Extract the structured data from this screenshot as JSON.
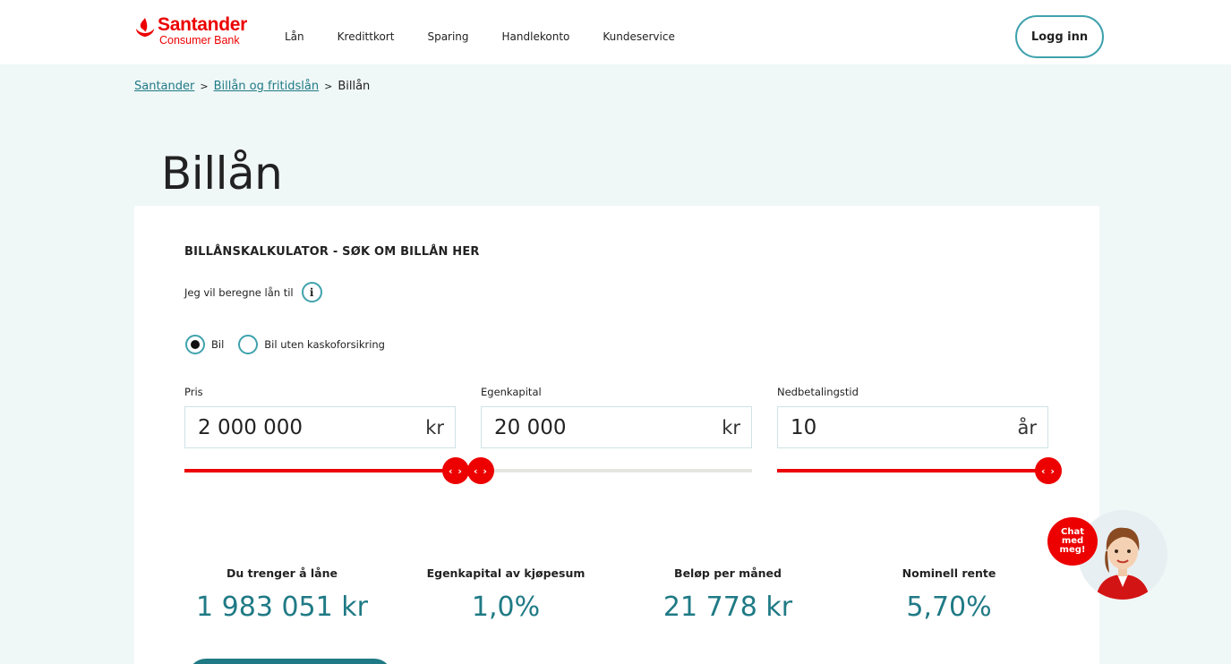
{
  "brand": {
    "name": "Santander",
    "sub": "Consumer Bank",
    "color": "#ec0000",
    "accent": "#3fa2ad"
  },
  "nav": {
    "items": [
      "Lån",
      "Kredittkort",
      "Sparing",
      "Handlekonto",
      "Kundeservice"
    ],
    "login_label": "Logg inn"
  },
  "breadcrumb": {
    "items": [
      "Santander",
      "Billån og fritidslån",
      "Billån"
    ],
    "separator": ">"
  },
  "page": {
    "title": "Billån"
  },
  "calculator": {
    "heading": "BILLÅNSKALKULATOR - SØK OM BILLÅN HER",
    "subheading": "Jeg vil beregne lån til",
    "info_icon": "info-icon",
    "options": [
      {
        "label": "Bil",
        "selected": true
      },
      {
        "label": "Bil uten kaskoforsikring",
        "selected": false
      }
    ],
    "fields": [
      {
        "label": "Pris",
        "value": "2 000 000",
        "unit": "kr",
        "slider_fraction": 1.0
      },
      {
        "label": "Egenkapital",
        "value": "20 000",
        "unit": "kr",
        "slider_fraction": 0.0
      },
      {
        "label": "Nedbetalingstid",
        "value": "10",
        "unit": "år",
        "slider_fraction": 1.0
      }
    ],
    "handle_glyph": "‹ ›",
    "results": [
      {
        "label": "Du trenger å låne",
        "value": "1 983 051 kr"
      },
      {
        "label": "Egenkapital av kjøpesum",
        "value": "1,0%"
      },
      {
        "label": "Beløp per måned",
        "value": "21 778 kr"
      },
      {
        "label": "Nominell rente",
        "value": "5,70%"
      }
    ]
  },
  "chat": {
    "lines": [
      "Chat",
      "med",
      "meg!"
    ]
  }
}
